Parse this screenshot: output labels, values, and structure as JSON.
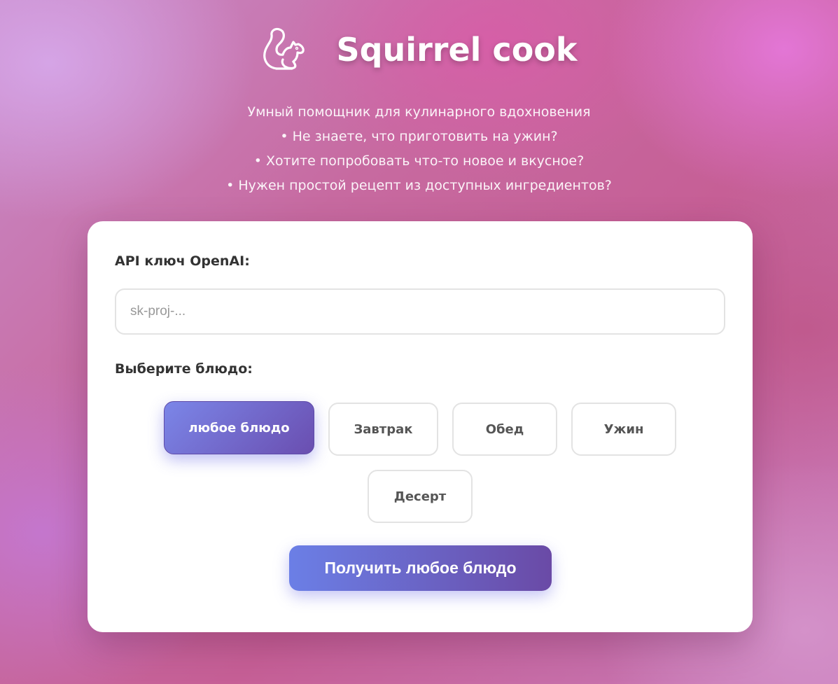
{
  "header": {
    "logo_icon": "squirrel-icon",
    "title": "Squirrel cook"
  },
  "subtitle": {
    "lines": [
      "Умный помощник для кулинарного вдохновения",
      "• Не знаете, что приготовить на ужин?",
      "• Хотите попробовать что-то новое и вкусное?",
      "• Нужен простой рецепт из доступных ингредиентов?"
    ]
  },
  "form": {
    "api_label": "API ключ OpenAI:",
    "api_value": "",
    "api_placeholder": "sk-proj-...",
    "dish_label": "Выберите блюдо:",
    "dish_options": [
      "любое блюдо",
      "Завтрак",
      "Обед",
      "Ужин",
      "Десерт"
    ],
    "selected_dish": "любое блюдо",
    "submit_label": "Получить любое блюдо"
  },
  "colors": {
    "accent_start": "#7b86e8",
    "accent_end": "#6a4eb0",
    "card_bg": "#ffffff"
  }
}
